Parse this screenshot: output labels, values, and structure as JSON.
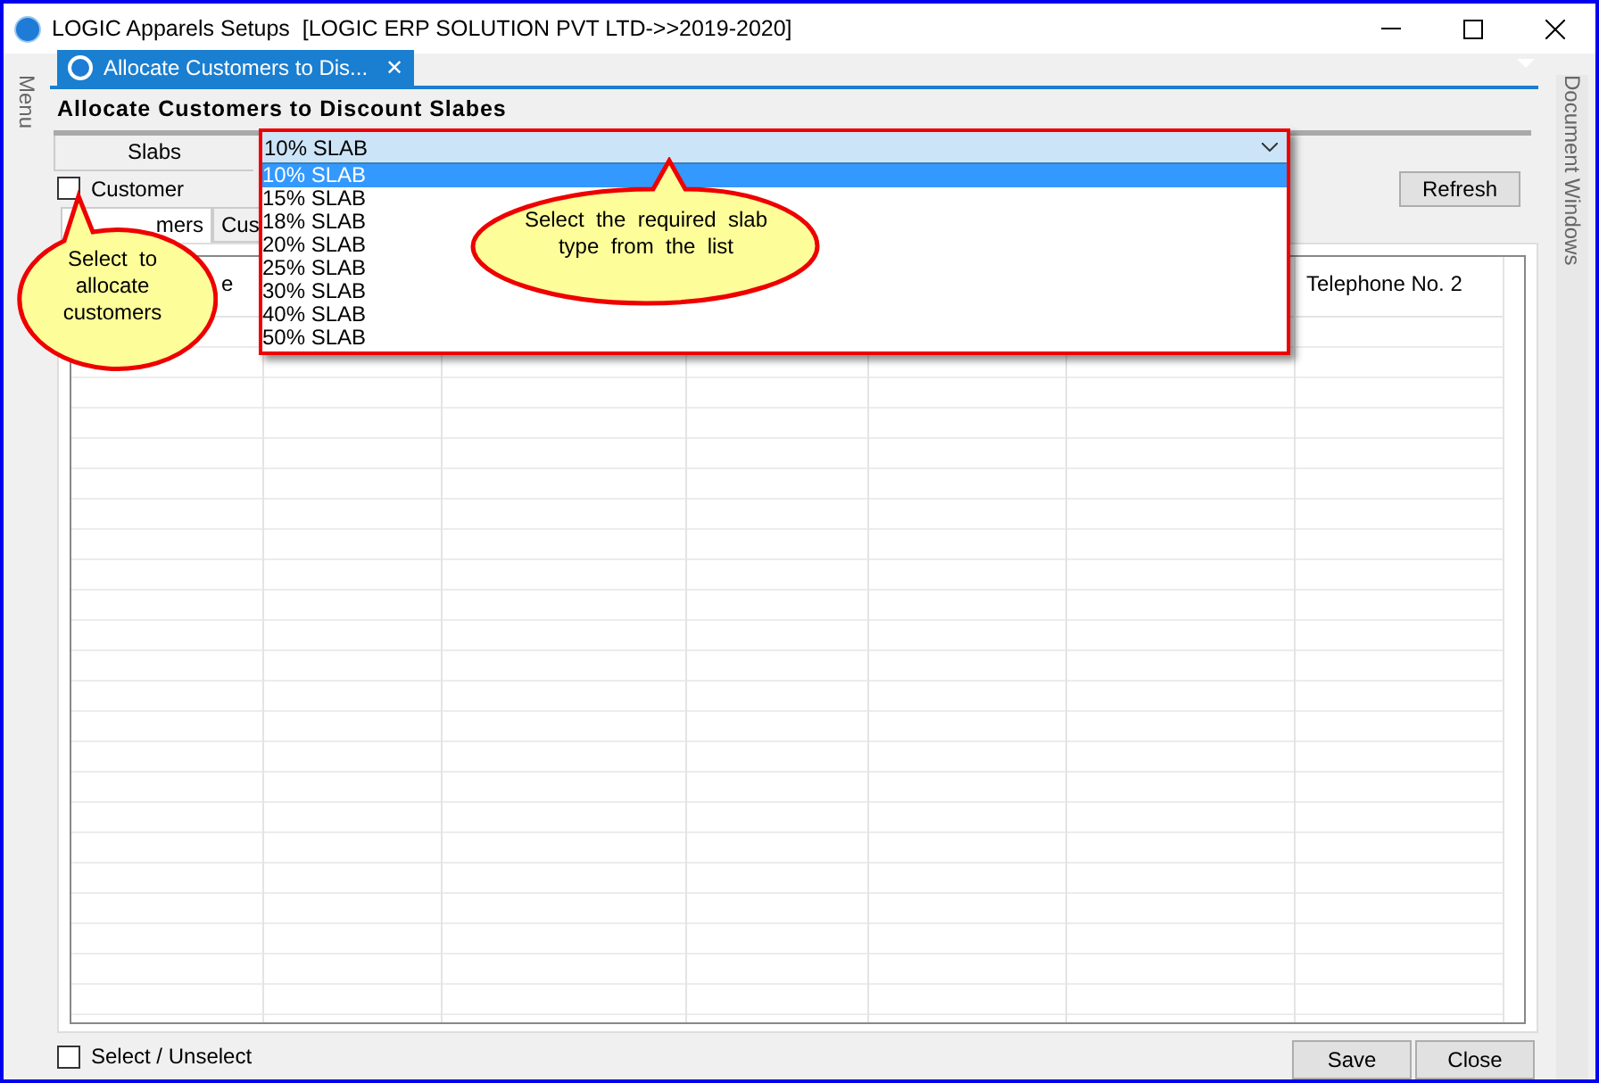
{
  "window": {
    "title": "LOGIC Apparels Setups  [LOGIC ERP SOLUTION PVT LTD->>2019-2020]"
  },
  "side_panels": {
    "left": "Menu",
    "right": "Document Windows"
  },
  "doc_tab": {
    "label": "Allocate Customers to Dis...",
    "close": "✕"
  },
  "heading": "Allocate Customers to Discount Slabes",
  "slabs": {
    "label": "Slabs",
    "value": "10% SLAB",
    "expanded": true,
    "options": [
      {
        "label": "10% SLAB",
        "selected": true
      },
      {
        "label": "15% SLAB",
        "selected": false
      },
      {
        "label": "18% SLAB",
        "selected": false
      },
      {
        "label": "20% SLAB",
        "selected": false
      },
      {
        "label": "25% SLAB",
        "selected": false
      },
      {
        "label": "30% SLAB",
        "selected": false
      },
      {
        "label": "40% SLAB",
        "selected": false
      },
      {
        "label": "50% SLAB",
        "selected": false
      }
    ]
  },
  "customer_checkbox": {
    "label": "Customer",
    "checked": false
  },
  "refresh": "Refresh",
  "tabs": [
    {
      "label": "mers",
      "selected": true
    },
    {
      "label": "Cus",
      "selected": false
    }
  ],
  "table": {
    "columns": [
      "e",
      "",
      "",
      "",
      "",
      "",
      "Telephone No. 2"
    ]
  },
  "callouts": [
    {
      "text": "Select  to allocate customers"
    },
    {
      "text": "Select  the  required  slab type  from  the  list"
    }
  ],
  "select_all": {
    "label": "Select / Unselect",
    "checked": false
  },
  "buttons": [
    "Save",
    "Close"
  ]
}
